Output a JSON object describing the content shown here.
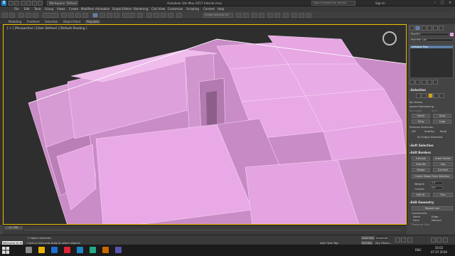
{
  "titlebar": {
    "workspace": "Workspace: Default",
    "title": "Autodesk 3ds Max 2017    Interior.max",
    "search_placeholder": "Type a keyword or phrase",
    "sign_in": "Sign In"
  },
  "menus": [
    "File",
    "Edit",
    "Tools",
    "Group",
    "Views",
    "Create",
    "Modifiers",
    "Animation",
    "Graph Editors",
    "Rendering",
    "Civil View",
    "Customize",
    "Scripting",
    "Content",
    "Help"
  ],
  "toolbar": {
    "selection_set_placeholder": "Create Selection Se"
  },
  "ribbon_tabs": [
    "Modeling",
    "Freeform",
    "Selection",
    "Object Paint",
    "Populate"
  ],
  "viewport": {
    "label": "[ + ] [Perspective ] [User Defined ] [Default Shading ]"
  },
  "command_panel": {
    "object_name": "Box001",
    "modifier_list": "Modifier List",
    "stack_item": "Editable Poly",
    "selection": {
      "header": "Selection",
      "by_vertex": "By Vertex",
      "ignore_backfacing": "Ignore Backfacing",
      "by_angle": "By Angle:",
      "by_angle_value": "45.0",
      "shrink": "Shrink",
      "grow": "Grow",
      "ring": "Ring",
      "loop": "Loop",
      "preview_selection": "Preview Selection",
      "preview_options": [
        "Off",
        "SubObj",
        "Multi"
      ],
      "status": "62 Edges Selected"
    },
    "soft_selection": {
      "header": "Soft Selection"
    },
    "edit_borders": {
      "header": "Edit Borders",
      "extrude": "Extrude",
      "insert_vertex": "Insert Vertex",
      "chamfer": "Chamfer",
      "cap": "Cap",
      "bridge": "Bridge",
      "connect": "Connect",
      "create_shape": "Create Shape From Selection",
      "weight_label": "Weight:",
      "weight_value": "1.0",
      "crease_label": "Crease:",
      "crease_value": "0.0",
      "edit_tri": "Edit Tri.",
      "turn": "Turn"
    },
    "edit_geometry": {
      "header": "Edit Geometry",
      "repeat_last": "Repeat Last",
      "constraints": "Constraints",
      "constraint_options": [
        "None",
        "Edge",
        "Face",
        "Normal"
      ],
      "preserve_uvs": "Preserve UVs",
      "create": "Create",
      "collapse": "Collapse"
    }
  },
  "timeline": {
    "frame": "0 / 100"
  },
  "status": {
    "selected": "1 Object Selected",
    "prompt": "Click or click-and-drag to select objects",
    "welcome": "Welcome to M",
    "add_time_tag": "Add Time Tag",
    "autokey": "Auto Key",
    "setkey": "Set Key",
    "selected_dropdown": "Selected",
    "key_filters": "Key Filters..."
  },
  "taskbar": {
    "lang": "ENG",
    "time": "16:02",
    "date": "07.07.2016"
  },
  "colors": {
    "model_fill": "#e4a3e1",
    "model_edge": "#f7d4f5",
    "viewport_bg": "#2e2e2e",
    "active_border": "#f0c000"
  }
}
